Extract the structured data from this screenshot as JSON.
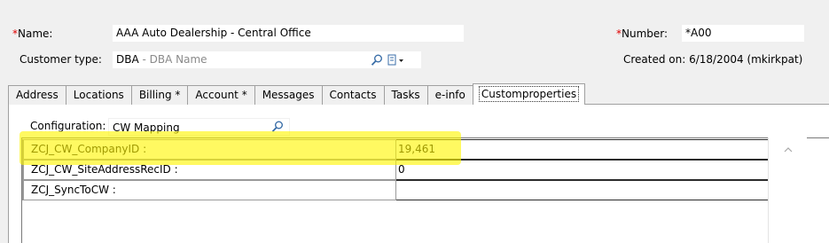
{
  "header": {
    "name_required_mark": "*",
    "name_label": "Name:",
    "name_value": "AAA Auto Dealership - Central Office",
    "number_required_mark": "*",
    "number_label": "Number:",
    "number_value": "*A00",
    "customer_type_label": "Customer type:",
    "customer_type_code": "DBA",
    "customer_type_desc": " - DBA Name",
    "created_label": "Created on: 6/18/2004 (mkirkpat)"
  },
  "tabs": [
    {
      "label": "Address"
    },
    {
      "label": "Locations"
    },
    {
      "label": "Billing *"
    },
    {
      "label": "Account *"
    },
    {
      "label": "Messages"
    },
    {
      "label": "Contacts"
    },
    {
      "label": "Tasks"
    },
    {
      "label": "e-info"
    },
    {
      "label": "Customproperties"
    }
  ],
  "active_tab_index": 8,
  "panel": {
    "configuration_label": "Configuration:",
    "configuration_value": "CW Mapping",
    "properties": [
      {
        "name": "ZCJ_CW_CompanyID :",
        "value": "19,461"
      },
      {
        "name": "ZCJ_CW_SiteAddressRecID :",
        "value": "0"
      },
      {
        "name": "ZCJ_SyncToCW :",
        "value": ""
      }
    ]
  },
  "colors": {
    "required": "#e00000",
    "highlight": "#fff600",
    "hint_text": "#8a8a8a"
  }
}
